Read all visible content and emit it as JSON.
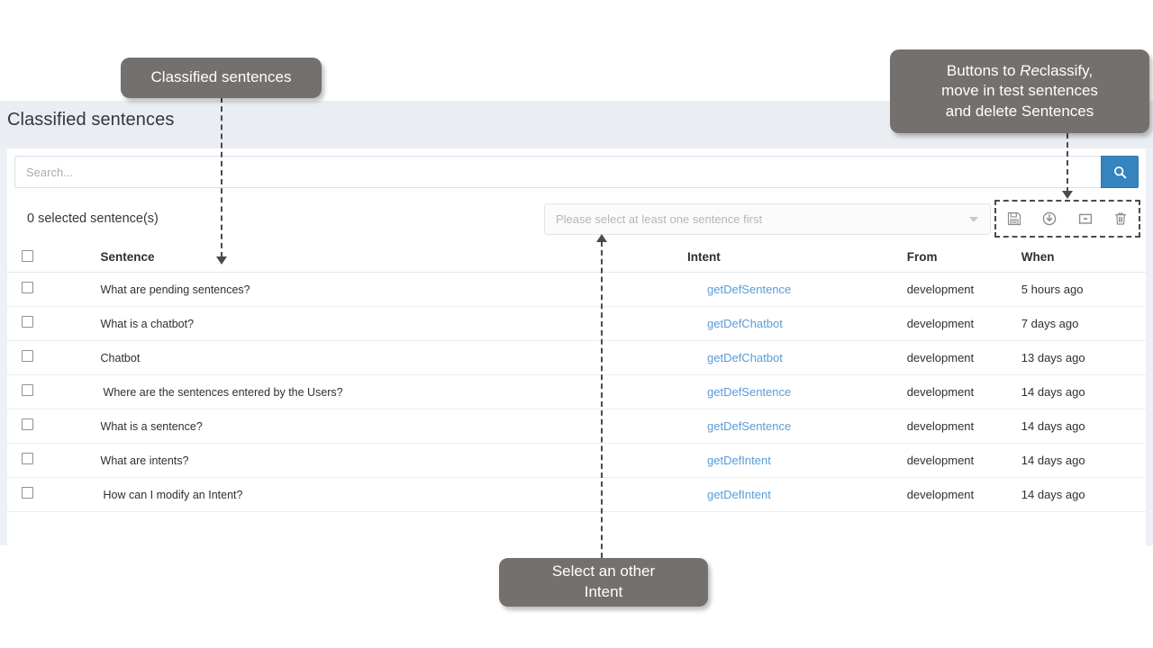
{
  "page": {
    "title": "Classified sentences"
  },
  "search": {
    "placeholder": "Search...",
    "value": "",
    "button_icon": "search-icon"
  },
  "toolbar": {
    "selected_count_label": "0 selected sentence(s)",
    "intent_select_placeholder": "Please select at least one sentence first",
    "icons": [
      {
        "name": "save-icon",
        "title": "Reclassify / Save"
      },
      {
        "name": "clock-arrow-icon",
        "title": "Move in test sentences"
      },
      {
        "name": "archive-box-icon",
        "title": "Archive"
      },
      {
        "name": "trash-icon",
        "title": "Delete sentences"
      }
    ]
  },
  "table": {
    "columns": [
      "Sentence",
      "Intent",
      "From",
      "When"
    ],
    "rows": [
      {
        "sentence": "What are pending sentences?",
        "intent": "getDefSentence",
        "from": "development",
        "when": "5 hours ago"
      },
      {
        "sentence": "What is a chatbot?",
        "intent": "getDefChatbot",
        "from": "development",
        "when": "7 days ago"
      },
      {
        "sentence": "Chatbot",
        "intent": "getDefChatbot",
        "from": "development",
        "when": "13 days ago"
      },
      {
        "sentence": "Where are the sentences entered by the Users?",
        "intent": "getDefSentence",
        "from": "development",
        "when": "14 days ago"
      },
      {
        "sentence": "What is a sentence?",
        "intent": "getDefSentence",
        "from": "development",
        "when": "14 days ago"
      },
      {
        "sentence": "What are intents?",
        "intent": "getDefIntent",
        "from": "development",
        "when": "14 days ago"
      },
      {
        "sentence": "How can I modify an Intent?",
        "intent": "getDefIntent",
        "from": "development",
        "when": "14 days ago"
      }
    ]
  },
  "annotations": {
    "classified": "Classified sentences",
    "buttons_line1_pre": "Buttons to ",
    "buttons_line1_em": "Re",
    "buttons_line1_post": "classify,",
    "buttons_line2": "move in test sentences",
    "buttons_line3": "and delete Sentences",
    "select_line1": "Select an other",
    "select_line2": "Intent"
  },
  "colors": {
    "accent_blue": "#3584bd",
    "link_blue": "#5b9bd5",
    "callout_gray": "#73706e",
    "header_bg": "#eaeef3"
  }
}
